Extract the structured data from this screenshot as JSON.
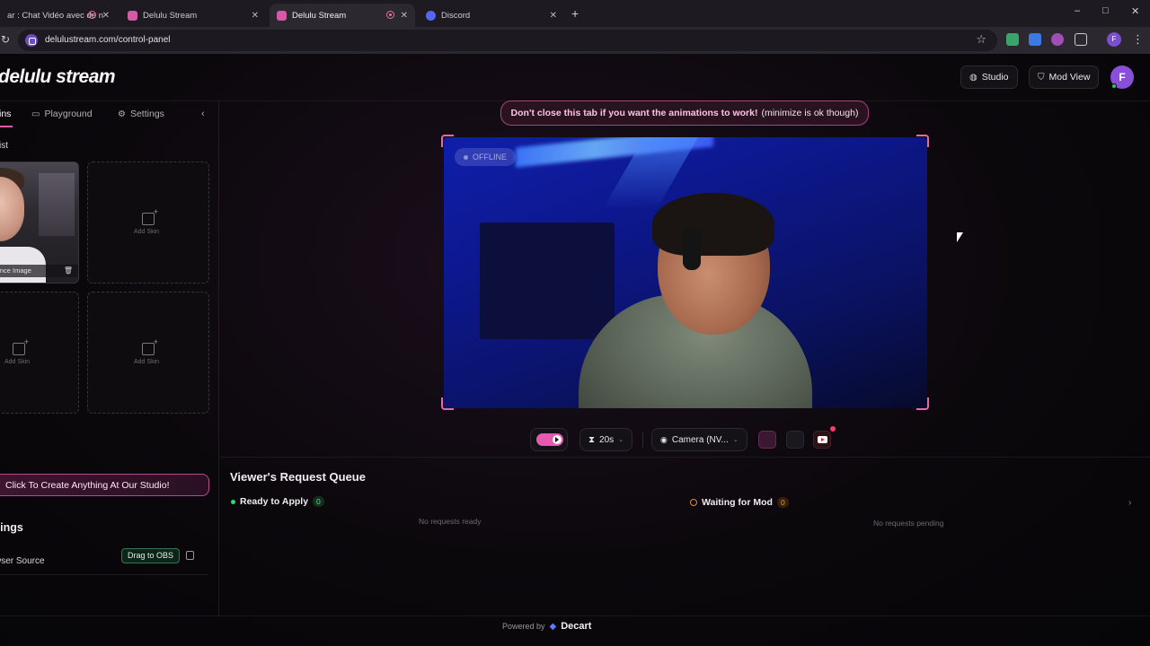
{
  "browser": {
    "tabs": [
      {
        "label": "ar : Chat Vidéo avec de n",
        "fav_color": "#1f1f1f",
        "recording": true
      },
      {
        "label": "Delulu Stream",
        "fav_color": "#d45aa7",
        "recording": false
      },
      {
        "label": "Delulu Stream",
        "fav_color": "#d45aa7",
        "recording": true,
        "active": true
      },
      {
        "label": "Discord",
        "fav_color": "#5865f2",
        "recording": false
      }
    ],
    "new_tab": "+",
    "url": "delulustream.com/control-panel",
    "window_controls": [
      "–",
      "□",
      "✕"
    ],
    "profile_initial": "F"
  },
  "header": {
    "logo": "delulu stream",
    "studio_label": "Studio",
    "modview_label": "Mod View",
    "avatar_initial": "F"
  },
  "sidebar": {
    "tabs": [
      {
        "label": "ins",
        "icon": "skins-icon",
        "active": true
      },
      {
        "label": "Playground",
        "icon": "playground-icon"
      },
      {
        "label": "Settings",
        "icon": "gear-icon"
      }
    ],
    "section_label": "ist",
    "skins": [
      {
        "type": "photo",
        "label": "erence Image"
      },
      {
        "type": "empty",
        "label": "Add Skin"
      },
      {
        "type": "empty",
        "label": "Add Skin"
      },
      {
        "type": "empty",
        "label": "Add Skin"
      }
    ],
    "cta": "Click To Create Anything At Our Studio!",
    "settings_title": "tings",
    "browser_source_label": "wser Source",
    "obs_button": "Drag to OBS"
  },
  "notice": {
    "bold": "Don't close this tab if you want the animations to work!",
    "rest": "(minimize is ok though)"
  },
  "preview": {
    "status": "OFFLINE"
  },
  "controls": {
    "timer": "20s",
    "camera": "Camera (NV...",
    "notification_count": 1
  },
  "queue": {
    "title": "Viewer's Request Queue",
    "ready_label": "Ready to Apply",
    "ready_count": "0",
    "ready_empty": "No requests ready",
    "waiting_label": "Waiting for Mod",
    "waiting_count": "0",
    "waiting_empty": "No requests pending"
  },
  "footer": {
    "powered_by": "Powered by",
    "brand": "Decart"
  },
  "colors": {
    "accent": "#e55aaf",
    "ready": "#2ed873",
    "waiting": "#e7873a"
  }
}
